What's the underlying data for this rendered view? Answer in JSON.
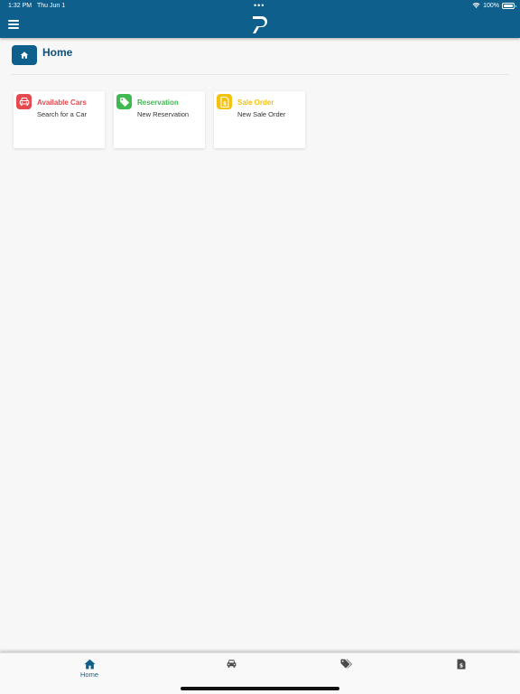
{
  "status_bar": {
    "time": "1:32 PM",
    "date": "Thu Jun 1",
    "battery": "100%",
    "battery_level": 1.0
  },
  "header": {
    "menu_icon": "hamburger-menu-icon",
    "logo_icon": "p-logo-icon"
  },
  "page": {
    "title": "Home",
    "badge_icon": "home-icon"
  },
  "cards": [
    {
      "title": "Available Cars",
      "subtitle": "Search for a Car",
      "icon": "car-icon",
      "color": "#e5484d"
    },
    {
      "title": "Reservation",
      "subtitle": "New Reservation",
      "icon": "tag-icon",
      "color": "#3fb950"
    },
    {
      "title": "Sale Order",
      "subtitle": "New Sale Order",
      "icon": "dollar-document-icon",
      "color": "#f4c20d"
    }
  ],
  "tabs": [
    {
      "label": "Home",
      "icon": "home-icon",
      "active": true
    },
    {
      "label": "",
      "icon": "car-icon",
      "active": false
    },
    {
      "label": "",
      "icon": "tags-icon",
      "active": false
    },
    {
      "label": "",
      "icon": "dollar-document-icon",
      "active": false
    }
  ],
  "colors": {
    "primary": "#0f5f8c",
    "background": "#f7f7f8",
    "tab_icon": "#4a4a4a"
  }
}
